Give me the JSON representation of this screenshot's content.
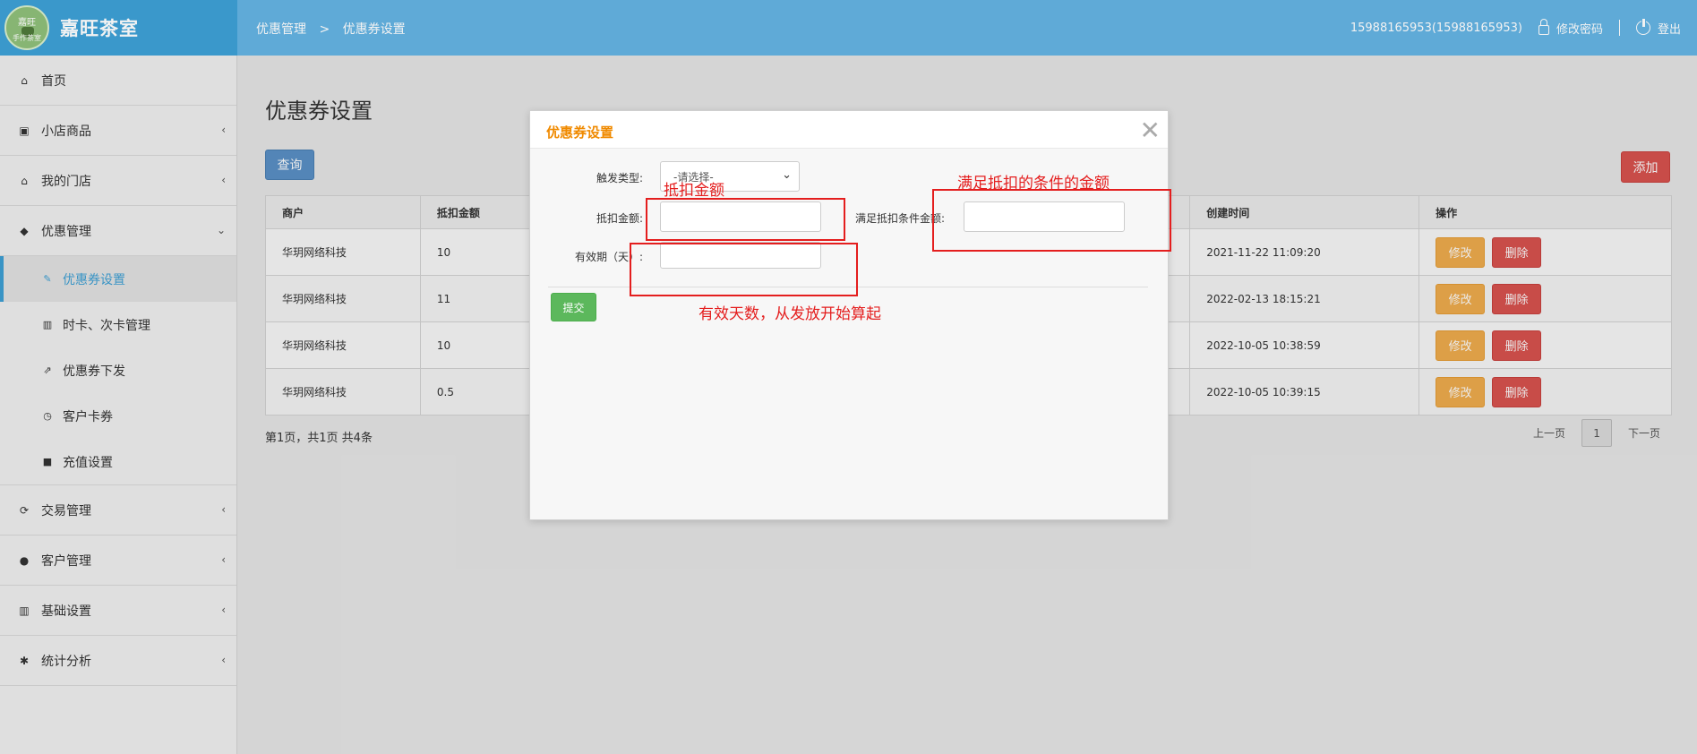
{
  "header": {
    "logo_line1": "嘉旺",
    "logo_line2": "手作茶室",
    "brand": "嘉旺茶室",
    "breadcrumb": [
      "优惠管理",
      ">",
      "优惠券设置"
    ],
    "user": "15988165953(15988165953)",
    "change_password": "修改密码",
    "logout": "登出"
  },
  "sidebar": {
    "items": [
      {
        "label": "首页",
        "icon": "home-icon",
        "glyph": "⌂"
      },
      {
        "label": "小店商品",
        "icon": "gift-icon",
        "glyph": "▣",
        "chevron": "‹"
      },
      {
        "label": "我的门店",
        "icon": "home-icon",
        "glyph": "⌂",
        "chevron": "‹"
      },
      {
        "label": "优惠管理",
        "icon": "tags-icon",
        "glyph": "◆",
        "chevron": "⌄"
      }
    ],
    "sub_items": [
      {
        "label": "优惠券设置",
        "icon": "tool-icon",
        "glyph": "✎"
      },
      {
        "label": "时卡、次卡管理",
        "icon": "barcode-icon",
        "glyph": "▥"
      },
      {
        "label": "优惠券下发",
        "icon": "share-icon",
        "glyph": "⇗"
      },
      {
        "label": "客户卡券",
        "icon": "clock-icon",
        "glyph": "◷"
      },
      {
        "label": "充值设置",
        "icon": "square-icon",
        "glyph": "■"
      }
    ],
    "items_after": [
      {
        "label": "交易管理",
        "icon": "refresh-icon",
        "glyph": "⟳",
        "chevron": "‹"
      },
      {
        "label": "客户管理",
        "icon": "user-icon",
        "glyph": "●",
        "chevron": "‹"
      },
      {
        "label": "基础设置",
        "icon": "barcode-icon",
        "glyph": "▥",
        "chevron": "‹"
      },
      {
        "label": "统计分析",
        "icon": "cog-icon",
        "glyph": "✱",
        "chevron": "‹"
      }
    ]
  },
  "main": {
    "title": "优惠券设置",
    "query_button": "查询",
    "add_button": "添加",
    "table": {
      "headers": [
        "商户",
        "抵扣金额",
        "创建时间",
        "操作"
      ],
      "rows": [
        {
          "merchant": "华玥网络科技",
          "amount": "10",
          "created": "2021-11-22 11:09:20"
        },
        {
          "merchant": "华玥网络科技",
          "amount": "11",
          "created": "2022-02-13 18:15:21"
        },
        {
          "merchant": "华玥网络科技",
          "amount": "10",
          "created": "2022-10-05 10:38:59"
        },
        {
          "merchant": "华玥网络科技",
          "amount": "0.5",
          "created": "2022-10-05 10:39:15"
        }
      ],
      "edit_label": "修改",
      "delete_label": "删除"
    },
    "summary": "第1页，共1页 共4条",
    "pager": {
      "prev": "上一页",
      "current": "1",
      "next": "下一页"
    }
  },
  "modal": {
    "title": "优惠券设置",
    "close": "✕",
    "trigger_type_label": "触发类型:",
    "trigger_type_value": "-请选择-",
    "deduct_amount_label": "抵扣金额:",
    "condition_amount_label": "满足抵扣条件金额:",
    "validity_label": "有效期（天）:",
    "submit": "提交"
  },
  "annotations": {
    "deduct": "抵扣金额",
    "condition": "满足抵扣的条件的金额",
    "validity": "有效天数，从发放开始算起"
  },
  "colors": {
    "header": "#65b4e3",
    "brand_bg": "#3ea1d6",
    "accent_orange": "#f08a00",
    "annotation_red": "#e41e1e"
  }
}
